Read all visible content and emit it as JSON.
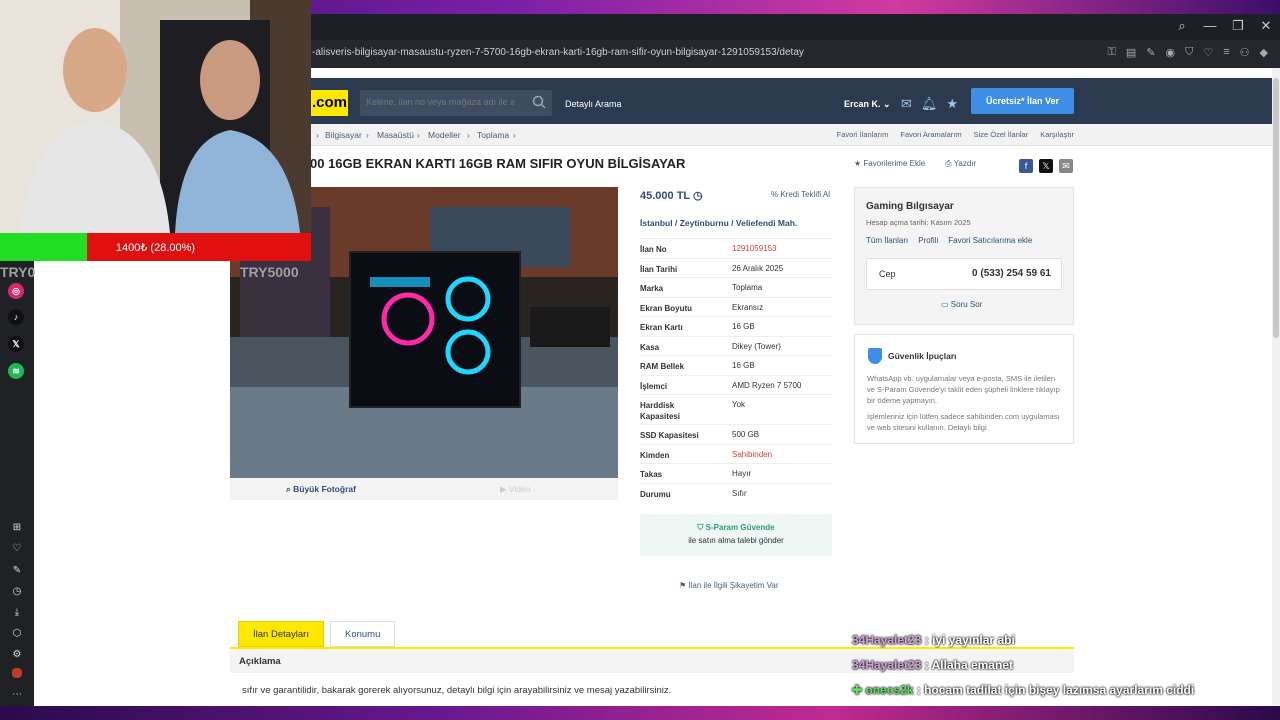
{
  "browser": {
    "url": "-alisveris-bilgisayar-masaustu-ryzen-7-5700-16gb-ekran-karti-16gb-ram-sifir-oyun-bilgisayar-1291059153/detay"
  },
  "header": {
    "logo": ".com",
    "search_placeholder": "Kelime, ilan no veya mağaza adı ile ara",
    "detailed_search": "Detaylı Arama",
    "user": "Ercan K.",
    "post_button": "Ücretsiz* İlan Ver"
  },
  "breadcrumbs": [
    "Bilgisayar",
    "Masaüstü",
    "Modeller",
    "Toplama"
  ],
  "top_links": [
    "Favori İlanlarım",
    "Favori Aramalarım",
    "Size Özel İlanlar",
    "Karşılaştır"
  ],
  "listing": {
    "title": "00 16GB EKRAN KARTI 16GB RAM SIFIR OYUN BİLGİSAYAR",
    "add_favorite": "Favorilerime Ekle",
    "print": "Yazdır",
    "price": "45.000 TL",
    "credit_offer": "Kredi Teklifi Al",
    "location": [
      "İstanbul",
      "Zeytinburnu",
      "Veliefendi Mah."
    ],
    "big_photo": "Büyük Fotoğraf",
    "video": "Video",
    "specs": [
      {
        "key": "İlan No",
        "value": "1291059153"
      },
      {
        "key": "İlan Tarihi",
        "value": "26 Aralık 2025"
      },
      {
        "key": "Marka",
        "value": "Toplama"
      },
      {
        "key": "Ekran Boyutu",
        "value": "Ekransız"
      },
      {
        "key": "Ekran Kartı",
        "value": "16 GB"
      },
      {
        "key": "Kasa",
        "value": "Dikey (Tower)"
      },
      {
        "key": "RAM Bellek",
        "value": "16 GB"
      },
      {
        "key": "İşlemci",
        "value": "AMD Ryzen 7 5700"
      },
      {
        "key": "Harddisk Kapasitesi",
        "value": "Yok"
      },
      {
        "key": "SSD Kapasitesi",
        "value": "500 GB"
      },
      {
        "key": "Kimden",
        "value": "Sahibinden"
      },
      {
        "key": "Takas",
        "value": "Hayır"
      },
      {
        "key": "Durumu",
        "value": "Sıfır"
      }
    ],
    "sparam_title": "S-Param Güvende",
    "sparam_sub": "ile satın alma talebi gönder",
    "complaint": "İlan ile İlgili Şikayetim Var"
  },
  "seller": {
    "name": "Gaming Bılgısayar",
    "since": "Hesap açma tarihi: Kasım 2025",
    "links": [
      "Tüm İlanları",
      "Profili",
      "Favori Satıcılarıma ekle"
    ],
    "phone_label": "Cep",
    "phone": "0 (533) 254 59 61",
    "ask": "Soru Sor"
  },
  "tips": {
    "title": "Güvenlik İpuçları",
    "p1": "WhatsApp vb. uygulamalar veya e-posta, SMS ile iletilen ve S-Param Güvende'yi taklit eden şüpheli linklere tıklayıp bir ödeme yapmayın.",
    "p2": "İşlemleriniz için lütfen sadece sahibinden.com uygulaması ve web sitesini kullanın. Detaylı bilgi"
  },
  "tabs": [
    "İlan Detayları",
    "Konumu"
  ],
  "description_title": "Açıklama",
  "description": "sıfır ve garantilidir, bakarak gorerek alıyorsunuz, detaylı bilgi için arayabilirsiniz ve mesaj yazabilirsiniz.",
  "stream": {
    "goal_text": "1400₺ (28.00%)",
    "goal_fraction": 0.28,
    "left_label": "TRY0",
    "right_label": "TRY5000",
    "chat": [
      {
        "user": "34Hayalet23",
        "msg": ": iyi yayınlar abi"
      },
      {
        "user": "34Hayalet23",
        "msg": ": Allaha emanet"
      },
      {
        "user": "onecs2k",
        "msg": ": hocam tadilat için bişey lazımsa ayarlarım ciddi"
      }
    ]
  },
  "colors": {
    "brand_yellow": "#ffe800",
    "header_bg": "#2b3a4f",
    "accent_blue": "#3f8ee6",
    "link": "#2f4f7a"
  }
}
